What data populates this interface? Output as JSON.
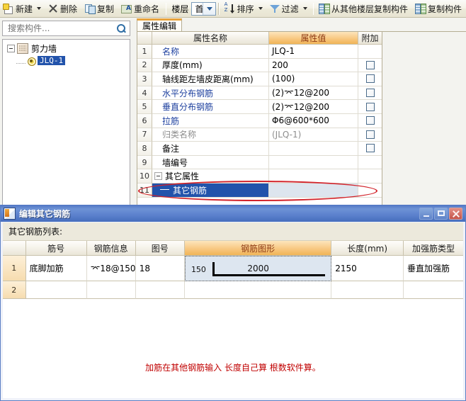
{
  "toolbar": {
    "items": [
      {
        "id": "new",
        "label": "新建",
        "icon": "new-icon",
        "has_caret": true
      },
      {
        "id": "delete",
        "label": "删除",
        "icon": "delete-icon",
        "has_caret": false
      },
      {
        "id": "copy",
        "label": "复制",
        "icon": "copy-icon",
        "has_caret": false
      },
      {
        "id": "rename",
        "label": "重命名",
        "icon": "rename-icon",
        "has_caret": false
      }
    ],
    "floor_label": "楼层",
    "floor_value": "首层",
    "sort_label": "排序",
    "filter_label": "过滤",
    "copy_from_other_floor": "从其他楼层复制构件",
    "copy_component": "复制构件"
  },
  "search": {
    "placeholder": "搜索构件...",
    "value": "",
    "icon": "search-icon"
  },
  "tree": {
    "root": {
      "label": "剪力墙",
      "icon": "wall-icon"
    },
    "child": {
      "label": "JLQ-1",
      "icon": "member-icon",
      "selected": true
    }
  },
  "tabs": [
    {
      "id": "property-edit",
      "label": "属性编辑",
      "active": true
    }
  ],
  "property_grid": {
    "headers": {
      "num": "",
      "name": "属性名称",
      "value": "属性值",
      "append": "附加"
    },
    "rows": [
      {
        "num": "1",
        "name": "名称",
        "value": "JLQ-1",
        "name_style": "blue",
        "value_style": "normal",
        "checkbox": false
      },
      {
        "num": "2",
        "name": "厚度(mm)",
        "value": "200",
        "name_style": "normal",
        "value_style": "normal",
        "checkbox": true
      },
      {
        "num": "3",
        "name": "轴线距左墙皮距离(mm)",
        "value": "(100)",
        "name_style": "normal",
        "value_style": "normal",
        "checkbox": true
      },
      {
        "num": "4",
        "name": "水平分布钢筋",
        "value": "(2)⌤12@200",
        "name_style": "blue",
        "value_style": "normal",
        "checkbox": true
      },
      {
        "num": "5",
        "name": "垂直分布钢筋",
        "value": "(2)⌤12@200",
        "name_style": "blue",
        "value_style": "normal",
        "checkbox": true
      },
      {
        "num": "6",
        "name": "拉筋",
        "value": "Φ6@600*600",
        "name_style": "blue",
        "value_style": "normal",
        "checkbox": true
      },
      {
        "num": "7",
        "name": "归类名称",
        "value": "(JLQ-1)",
        "name_style": "gray",
        "value_style": "gray",
        "checkbox": true
      },
      {
        "num": "8",
        "name": "备注",
        "value": "",
        "name_style": "normal",
        "value_style": "normal",
        "checkbox": true
      },
      {
        "num": "9",
        "name": "墙编号",
        "value": "",
        "name_style": "normal",
        "value_style": "normal",
        "checkbox": false
      },
      {
        "num": "10",
        "name": "其它属性",
        "value": "",
        "name_style": "normal",
        "value_style": "normal",
        "checkbox": false,
        "group": true
      },
      {
        "num": "11",
        "name": "其它钢筋",
        "value": "",
        "name_style": "normal",
        "value_style": "normal",
        "checkbox": false,
        "selected": true,
        "sub": true
      }
    ]
  },
  "dialog": {
    "title": "编辑其它钢筋",
    "icon": "app-icon",
    "window_buttons": {
      "minimize": "minimize-button",
      "maximize": "maximize-button",
      "close": "close-button"
    },
    "list_label": "其它钢筋列表:",
    "headers": [
      "",
      "筋号",
      "钢筋信息",
      "图号",
      "钢筋图形",
      "长度(mm)",
      "加强筋类型"
    ],
    "highlight_header": "钢筋图形",
    "rows": [
      {
        "num": "1",
        "bar_name": "底脚加筋",
        "bar_info": "⌤18@150",
        "fig_no": "18",
        "shape": {
          "leg": "150",
          "main": "2000"
        },
        "length": "2150",
        "type": "垂直加强筋"
      },
      {
        "num": "2",
        "bar_name": "",
        "bar_info": "",
        "fig_no": "",
        "shape": {
          "leg": "",
          "main": ""
        },
        "length": "",
        "type": ""
      }
    ],
    "note": "加筋在其他钢筋输入 长度自己算 根数软件算。",
    "note_color": "#c00000"
  },
  "annotation": {
    "ellipse_color": "#d2232a"
  }
}
